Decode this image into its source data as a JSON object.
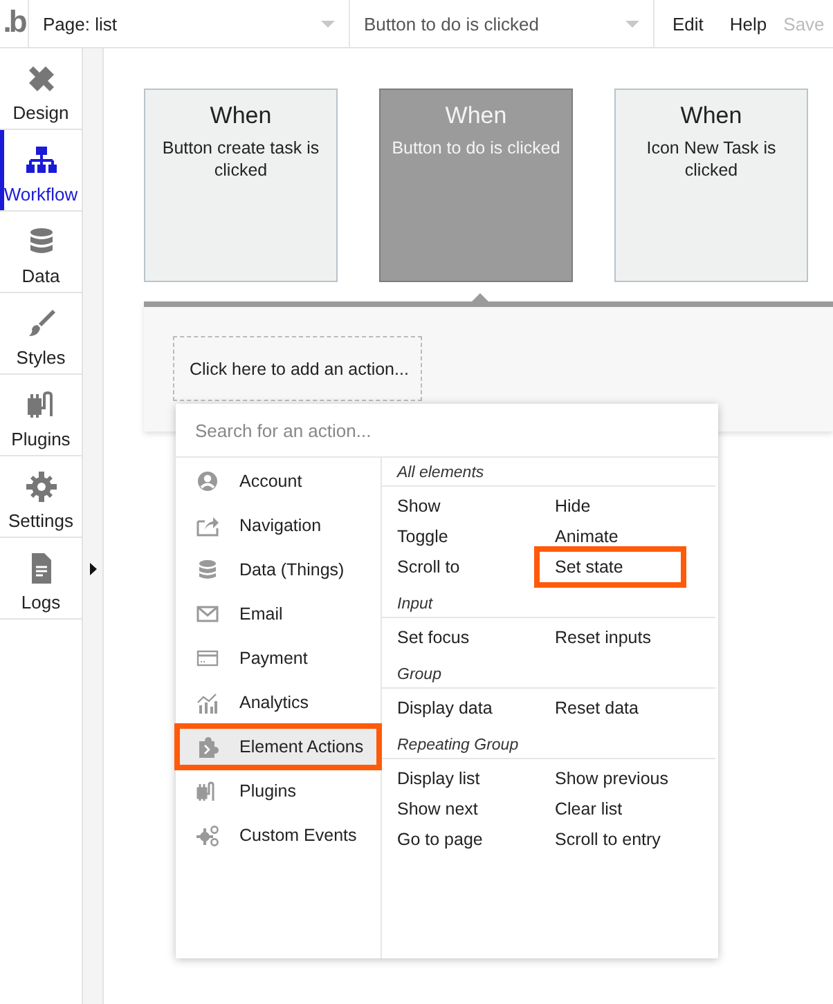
{
  "topbar": {
    "logo": ".b",
    "page_selector": "Page: list",
    "event_selector": "Button to do is clicked",
    "menu": [
      "Edit",
      "Help"
    ],
    "status": "Save"
  },
  "sidebar": {
    "items": [
      {
        "label": "Design",
        "selected": false
      },
      {
        "label": "Workflow",
        "selected": true
      },
      {
        "label": "Data",
        "selected": false
      },
      {
        "label": "Styles",
        "selected": false
      },
      {
        "label": "Plugins",
        "selected": false
      },
      {
        "label": "Settings",
        "selected": false
      },
      {
        "label": "Logs",
        "selected": false
      }
    ]
  },
  "events": [
    {
      "title": "When",
      "label": "Button create task is clicked",
      "selected": false
    },
    {
      "title": "When",
      "label": "Button to do is clicked",
      "selected": true
    },
    {
      "title": "When",
      "label": "Icon New Task is clicked",
      "selected": false
    }
  ],
  "actions_panel": {
    "add_action": "Click here to add an action..."
  },
  "action_menu": {
    "search": {
      "placeholder": "Search for an action..."
    },
    "categories": [
      {
        "label": "Account",
        "selected": false,
        "highlighted": false
      },
      {
        "label": "Navigation",
        "selected": false,
        "highlighted": false
      },
      {
        "label": "Data (Things)",
        "selected": false,
        "highlighted": false
      },
      {
        "label": "Email",
        "selected": false,
        "highlighted": false
      },
      {
        "label": "Payment",
        "selected": false,
        "highlighted": false
      },
      {
        "label": "Analytics",
        "selected": false,
        "highlighted": false
      },
      {
        "label": "Element Actions",
        "selected": true,
        "highlighted": true
      },
      {
        "label": "Plugins",
        "selected": false,
        "highlighted": false
      },
      {
        "label": "Custom Events",
        "selected": false,
        "highlighted": false
      }
    ],
    "sections": [
      {
        "title": "All elements",
        "actions": [
          {
            "label": "Show",
            "highlighted": false
          },
          {
            "label": "Hide",
            "highlighted": false
          },
          {
            "label": "Toggle",
            "highlighted": false
          },
          {
            "label": "Animate",
            "highlighted": false
          },
          {
            "label": "Scroll to",
            "highlighted": false
          },
          {
            "label": "Set state",
            "highlighted": true
          }
        ]
      },
      {
        "title": "Input",
        "actions": [
          {
            "label": "Set focus",
            "highlighted": false
          },
          {
            "label": "Reset inputs",
            "highlighted": false
          }
        ]
      },
      {
        "title": "Group",
        "actions": [
          {
            "label": "Display data",
            "highlighted": false
          },
          {
            "label": "Reset data",
            "highlighted": false
          }
        ]
      },
      {
        "title": "Repeating Group",
        "actions": [
          {
            "label": "Display list",
            "highlighted": false
          },
          {
            "label": "Show previous",
            "highlighted": false
          },
          {
            "label": "Show next",
            "highlighted": false
          },
          {
            "label": "Clear list",
            "highlighted": false
          },
          {
            "label": "Go to page",
            "highlighted": false
          },
          {
            "label": "Scroll to entry",
            "highlighted": false
          }
        ]
      }
    ]
  }
}
